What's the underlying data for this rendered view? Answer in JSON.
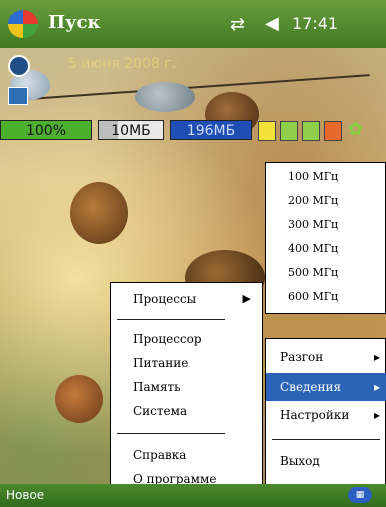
{
  "titlebar": {
    "title": "Пуск",
    "time": "17:41",
    "start_icon": "windows-flag-icon",
    "signal_icon": "signal-icon",
    "volume_icon": "volume-icon"
  },
  "today": {
    "date": "5 июня 2008 г."
  },
  "gauges": {
    "battery": "100%",
    "memory": "10МБ",
    "memory_fill_fraction": 0.3,
    "storage": "196МБ"
  },
  "cpu_freq_menu": {
    "items": [
      "100 МГц",
      "200 МГц",
      "300 МГц",
      "400 МГц",
      "500 МГц",
      "600 МГц"
    ]
  },
  "main_menu": {
    "items": [
      "Разгон",
      "Сведения",
      "Настройки",
      "Выход"
    ],
    "selected": "Сведения"
  },
  "process_menu": {
    "items": [
      "Процессы",
      "Процессор",
      "Питание",
      "Память",
      "Система",
      "Справка",
      "О программе"
    ]
  },
  "bottombar": {
    "left_softkey": "Новое"
  },
  "colors": {
    "accent_green": "#4c8a2c",
    "menu_selection": "#2b64b7",
    "battery": "#4caf2e",
    "storage": "#1f4fb4"
  }
}
